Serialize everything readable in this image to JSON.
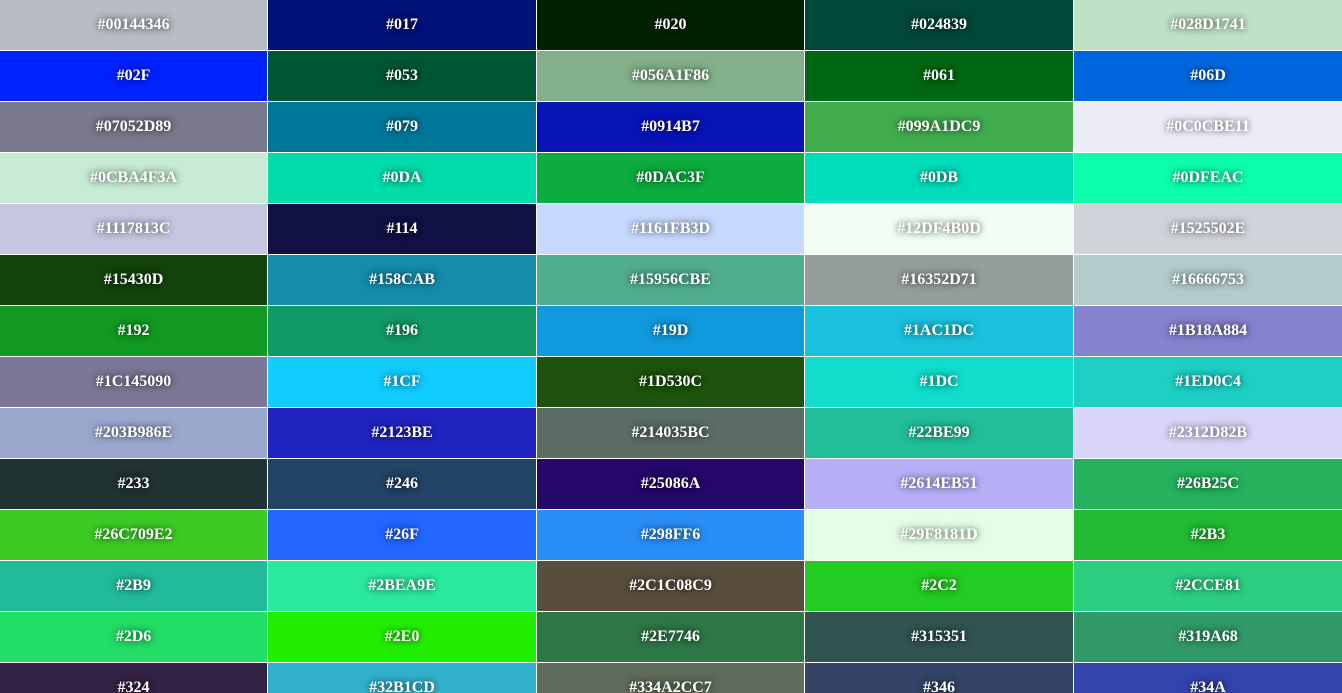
{
  "swatches": [
    {
      "label": "#00144346",
      "color": "#B8BCC4"
    },
    {
      "label": "#017",
      "color": "#001177"
    },
    {
      "label": "#020",
      "color": "#002200"
    },
    {
      "label": "#024839",
      "color": "#024839"
    },
    {
      "label": "#028D1741",
      "color": "#C1E1C6"
    },
    {
      "label": "#02F",
      "color": "#0022FF"
    },
    {
      "label": "#053",
      "color": "#005533"
    },
    {
      "label": "#056A1F86",
      "color": "#83B08A"
    },
    {
      "label": "#061",
      "color": "#006611"
    },
    {
      "label": "#06D",
      "color": "#0066DD"
    },
    {
      "label": "#07052D89",
      "color": "#7A798D"
    },
    {
      "label": "#079",
      "color": "#007799"
    },
    {
      "label": "#0914B7",
      "color": "#0914B7"
    },
    {
      "label": "#099A1DC9",
      "color": "#41AD4F"
    },
    {
      "label": "#0C0CBE11",
      "color": "#EDEDF8"
    },
    {
      "label": "#0CBA4F3A",
      "color": "#C7EBD5"
    },
    {
      "label": "#0DA",
      "color": "#00DDAA"
    },
    {
      "label": "#0DAC3F",
      "color": "#0DAC3F"
    },
    {
      "label": "#0DB",
      "color": "#00DDBB"
    },
    {
      "label": "#0DFEAC",
      "color": "#0DFEAC"
    },
    {
      "label": "#1117813C",
      "color": "#C6C6E1"
    },
    {
      "label": "#114",
      "color": "#111144"
    },
    {
      "label": "#1161FB3D",
      "color": "#C7D9FE"
    },
    {
      "label": "#12DF4B0D",
      "color": "#F1FEF4"
    },
    {
      "label": "#1525502E",
      "color": "#D0D3DA"
    },
    {
      "label": "#15430D",
      "color": "#15430D"
    },
    {
      "label": "#158CAB",
      "color": "#158CAB"
    },
    {
      "label": "#15956CBE",
      "color": "#51AD8F"
    },
    {
      "label": "#16352D71",
      "color": "#959E9C"
    },
    {
      "label": "#16666753",
      "color": "#B3CBCB"
    },
    {
      "label": "#192",
      "color": "#119922"
    },
    {
      "label": "#196",
      "color": "#119966"
    },
    {
      "label": "#19D",
      "color": "#1199DD"
    },
    {
      "label": "#1AC1DC",
      "color": "#1AC1DC"
    },
    {
      "label": "#1B18A884",
      "color": "#8583CE"
    },
    {
      "label": "#1C145090",
      "color": "#7B7897"
    },
    {
      "label": "#1CF",
      "color": "#11CCFF"
    },
    {
      "label": "#1D530C",
      "color": "#1D530C"
    },
    {
      "label": "#1DC",
      "color": "#11DDCC"
    },
    {
      "label": "#1ED0C4",
      "color": "#1ED0C4"
    },
    {
      "label": "#203B986E",
      "color": "#9BA8CE"
    },
    {
      "label": "#2123BE",
      "color": "#2123BE"
    },
    {
      "label": "#214035BC",
      "color": "#5C6D66"
    },
    {
      "label": "#22BE99",
      "color": "#22BE99"
    },
    {
      "label": "#2312D82B",
      "color": "#D8D5F8"
    },
    {
      "label": "#233",
      "color": "#223333"
    },
    {
      "label": "#246",
      "color": "#224466"
    },
    {
      "label": "#25086A",
      "color": "#25086A"
    },
    {
      "label": "#2614EB51",
      "color": "#B7B0F6"
    },
    {
      "label": "#26B25C",
      "color": "#26B25C"
    },
    {
      "label": "#26C709E2",
      "color": "#3CCB25"
    },
    {
      "label": "#26F",
      "color": "#2266FF"
    },
    {
      "label": "#298FF6",
      "color": "#298FF6"
    },
    {
      "label": "#29F8181D",
      "color": "#E3FEE5"
    },
    {
      "label": "#2B3",
      "color": "#22BB33"
    },
    {
      "label": "#2B9",
      "color": "#22BB99"
    },
    {
      "label": "#2BEA9E",
      "color": "#2BEA9E"
    },
    {
      "label": "#2C1C08C9",
      "color": "#594E3E"
    },
    {
      "label": "#2C2",
      "color": "#22CC22"
    },
    {
      "label": "#2CCE81",
      "color": "#2CCE81"
    },
    {
      "label": "#2D6",
      "color": "#22DD66"
    },
    {
      "label": "#2E0",
      "color": "#22EE00"
    },
    {
      "label": "#2E7746",
      "color": "#2E7746"
    },
    {
      "label": "#315351",
      "color": "#315351"
    },
    {
      "label": "#319A68",
      "color": "#319A68"
    },
    {
      "label": "#324",
      "color": "#332244"
    },
    {
      "label": "#32B1CD",
      "color": "#32B1CD"
    },
    {
      "label": "#334A2CC7",
      "color": "#5F6B5B"
    },
    {
      "label": "#346",
      "color": "#334466"
    },
    {
      "label": "#34A",
      "color": "#3344AA"
    }
  ]
}
